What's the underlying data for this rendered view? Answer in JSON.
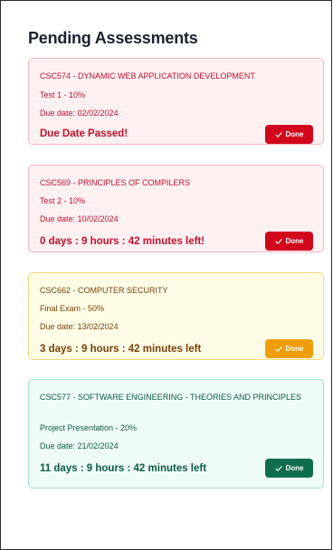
{
  "page": {
    "title": "Pending Assessments"
  },
  "assessments": [
    {
      "course": "CSC574 - DYNAMIC WEB APPLICATION DEVELOPMENT",
      "assessment": "Test 1 - 10%",
      "due": "Due date: 02/02/2024",
      "status": "Due Date Passed!",
      "button_label": "Done",
      "theme": "red"
    },
    {
      "course": "CSC569 - PRINCIPLES OF COMPILERS",
      "assessment": "Test 2 - 10%",
      "due": "Due date: 10/02/2024",
      "status": "0 days : 9 hours : 42 minutes left!",
      "button_label": "Done",
      "theme": "red"
    },
    {
      "course": "CSC662 - COMPUTER SECURITY",
      "assessment": "Final Exam - 50%",
      "due": "Due date: 13/02/2024",
      "status": "3 days : 9 hours : 42 minutes left",
      "button_label": "Done",
      "theme": "yellow"
    },
    {
      "course": "CSC577 - SOFTWARE ENGINEERING - THEORIES AND PRINCIPLES",
      "assessment": "Project Presentation - 20%",
      "due": "Due date: 21/02/2024",
      "status": "11 days : 9 hours : 42 minutes left",
      "button_label": "Done",
      "theme": "green"
    }
  ],
  "colors": {
    "overdue_red": "#d1061c",
    "warning_amber": "#ef9e0b",
    "ok_green": "#0f6d4f"
  },
  "icons": {
    "done_button": "check-icon"
  }
}
